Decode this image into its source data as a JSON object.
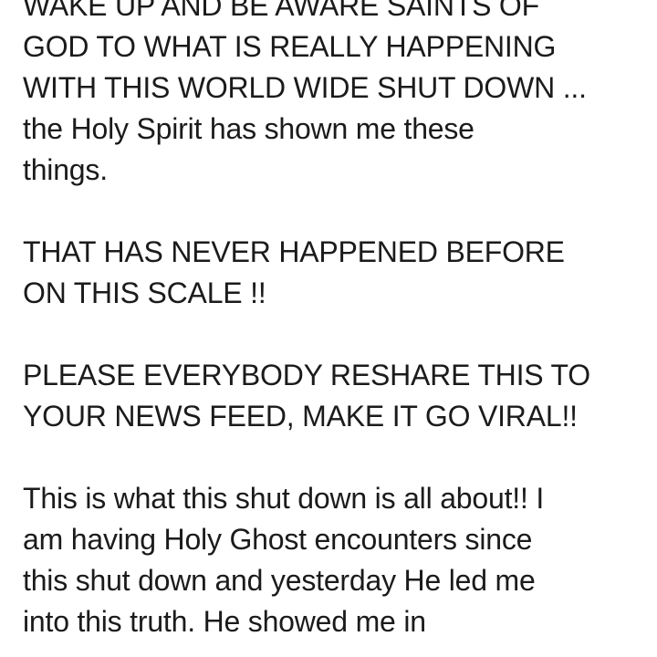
{
  "post": {
    "paragraphs": [
      {
        "lines": [
          "WAKE UP AND BE AWARE SAINTS OF",
          "GOD TO  WHAT IS REALLY HAPPENING",
          "WITH THIS WORLD WIDE SHUT DOWN ...",
          "the Holy Spirit has shown me these",
          "things."
        ]
      },
      {
        "lines": [
          "THAT HAS NEVER HAPPENED BEFORE",
          "ON THIS SCALE !!"
        ]
      },
      {
        "lines": [
          "PLEASE EVERYBODY RESHARE THIS TO",
          "YOUR NEWS FEED, MAKE IT GO VIRAL!!"
        ]
      },
      {
        "lines": [
          "This is what this shut down is all about!! I",
          "am having Holy Ghost encounters since",
          "this shut down and yesterday He led me",
          "into this truth. He showed me in"
        ]
      }
    ]
  }
}
